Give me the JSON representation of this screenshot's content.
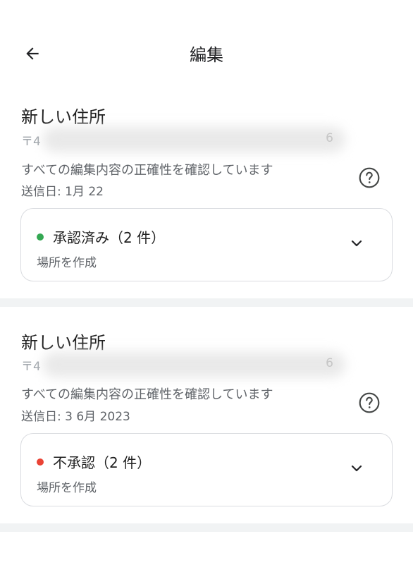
{
  "header": {
    "title": "編集"
  },
  "edits": [
    {
      "title": "新しい住所",
      "address_prefix": "〒4",
      "address_suffix": "6",
      "description": "すべての編集内容の正確性を確認しています",
      "sent": "送信日: 1月 22",
      "status": "承認済み（2 件）",
      "status_color": "#34a853",
      "action": "場所を作成"
    },
    {
      "title": "新しい住所",
      "address_prefix": "〒4",
      "address_suffix": "6",
      "description": "すべての編集内容の正確性を確認しています",
      "sent": "送信日: 3 6月 2023",
      "status": "不承認（2 件）",
      "status_color": "#ea4335",
      "action": "場所を作成"
    }
  ]
}
